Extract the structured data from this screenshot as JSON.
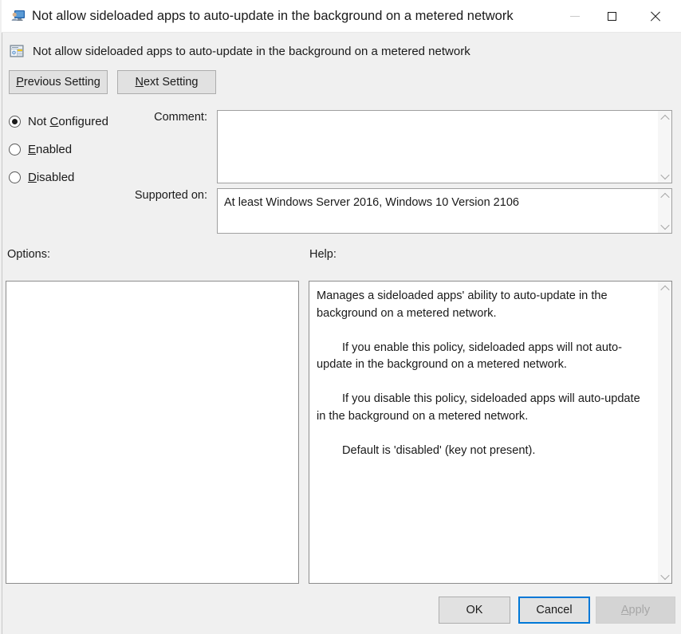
{
  "window": {
    "title": "Not allow sideloaded apps to auto-update in the background on a metered network",
    "icon": "policy-user-monitor-icon",
    "controls": {
      "minimize_label": "—",
      "maximize_label": "□",
      "close_label": "✕"
    }
  },
  "header": {
    "policy_name": "Not allow sideloaded apps to auto-update in the background on a metered network",
    "icon": "policy-setting-icon"
  },
  "navigation": {
    "previous_setting": "Previous Setting",
    "previous_accel": "P",
    "next_setting": "Next Setting",
    "next_accel": "N"
  },
  "state_options": {
    "selected": "Not Configured",
    "items": [
      {
        "label": "Not Configured",
        "accel": "C",
        "pre": "Not ",
        "post": "onfigured",
        "checked": true
      },
      {
        "label": "Enabled",
        "accel": "E",
        "pre": "",
        "post": "nabled",
        "checked": false
      },
      {
        "label": "Disabled",
        "accel": "D",
        "pre": "",
        "post": "isabled",
        "checked": false
      }
    ]
  },
  "comment": {
    "label": "Comment:",
    "value": "",
    "placeholder": ""
  },
  "supported_on": {
    "label": "Supported on:",
    "value": "At least Windows Server 2016, Windows 10 Version 2106"
  },
  "options_section": {
    "label": "Options:",
    "content": ""
  },
  "help_section": {
    "label": "Help:",
    "paragraphs": [
      "Manages a sideloaded apps' ability to auto-update in the background on a metered network.",
      "If you enable this policy, sideloaded apps will not auto-update in the background on a metered network.",
      "If you disable this policy, sideloaded apps will auto-update in the background on a metered network.",
      "Default is 'disabled' (key not present)."
    ]
  },
  "footer": {
    "ok_label": "OK",
    "cancel_label": "Cancel",
    "apply_label": "Apply",
    "apply_accel": "A",
    "apply_disabled": true,
    "focused_button": "Cancel"
  },
  "colors": {
    "dialog_background": "#f0f0f0",
    "titlebar_background": "#ffffff",
    "focus_border": "#0078d7",
    "disabled_text": "#a7a7a7",
    "text": "#1a1a1a"
  }
}
